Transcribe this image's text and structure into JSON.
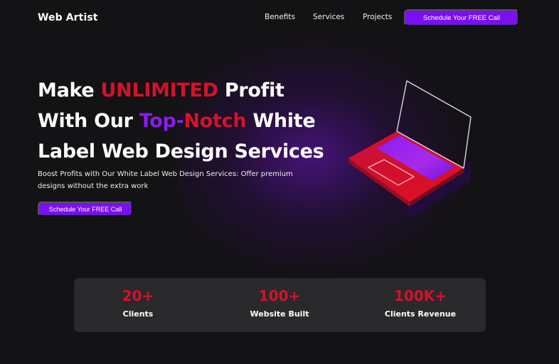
{
  "header": {
    "logo": "Web Artist",
    "nav": [
      "Benefits",
      "Services",
      "Projects"
    ],
    "cta": "Schedule Your FREE Call"
  },
  "hero": {
    "line1": {
      "a": "Make ",
      "b": "UNLIMITED",
      "c": " Profit"
    },
    "line2": {
      "a": "With Our ",
      "b": "Top-",
      "c": "Notch",
      "d": " White"
    },
    "line3": "Label Web Design Services",
    "subtext": "Boost Profits with Our White Label Web Design Services: Offer premium designs without the extra work",
    "cta": "Schedule Your FREE Call",
    "illustration_icon": "laptop-icon"
  },
  "stats": [
    {
      "value": "20+",
      "label": "Clients"
    },
    {
      "value": "100+",
      "label": "Website Built"
    },
    {
      "value": "100K+",
      "label": "Clients Revenue"
    }
  ],
  "colors": {
    "background": "#131214",
    "accent_purple": "#7a0ff0",
    "accent_red": "#d4122a",
    "stats_panel": "#2a292b"
  }
}
